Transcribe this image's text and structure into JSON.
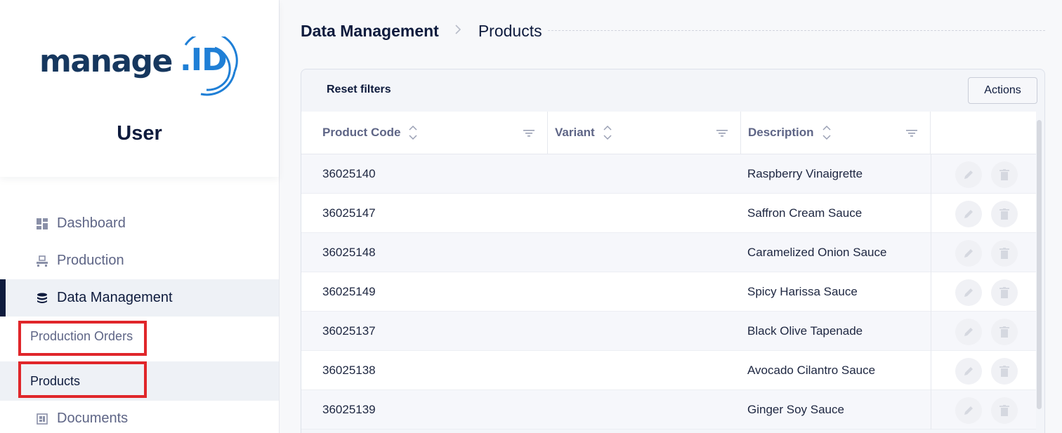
{
  "logo": {
    "word": "manage",
    "suffix": ".ID"
  },
  "sidebar": {
    "title": "User",
    "items": [
      {
        "label": "Dashboard",
        "icon": "dashboard-icon"
      },
      {
        "label": "Production",
        "icon": "production-icon"
      },
      {
        "label": "Data Management",
        "icon": "database-icon",
        "active": true
      }
    ],
    "sub_items": [
      {
        "label": "Production Orders"
      },
      {
        "label": "Products",
        "active": true
      }
    ],
    "after_items": [
      {
        "label": "Documents",
        "icon": "documents-icon"
      }
    ]
  },
  "breadcrumb": {
    "root": "Data Management",
    "current": "Products"
  },
  "toolbar": {
    "reset_label": "Reset filters",
    "actions_label": "Actions"
  },
  "table": {
    "columns": [
      "Product Code",
      "Variant",
      "Description"
    ],
    "rows": [
      {
        "code": "36025140",
        "variant": "",
        "description": "Raspberry Vinaigrette"
      },
      {
        "code": "36025147",
        "variant": "",
        "description": "Saffron Cream Sauce"
      },
      {
        "code": "36025148",
        "variant": "",
        "description": "Caramelized Onion Sauce"
      },
      {
        "code": "36025149",
        "variant": "",
        "description": "Spicy Harissa Sauce"
      },
      {
        "code": "36025137",
        "variant": "",
        "description": "Black Olive Tapenade"
      },
      {
        "code": "36025138",
        "variant": "",
        "description": "Avocado Cilantro Sauce"
      },
      {
        "code": "36025139",
        "variant": "",
        "description": "Ginger Soy Sauce"
      }
    ]
  },
  "colors": {
    "primary": "#0e1b3d",
    "accent": "#1f7fd6",
    "highlight": "#e0262a"
  }
}
